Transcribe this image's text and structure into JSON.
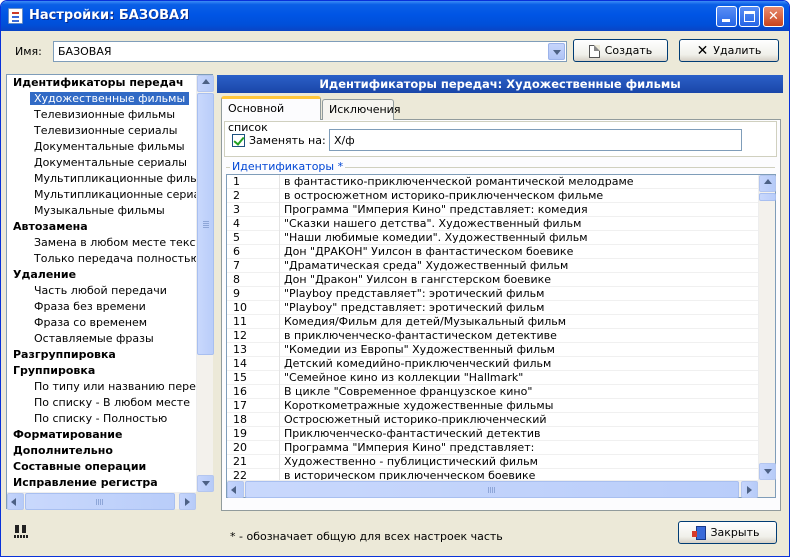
{
  "window": {
    "title": "Настройки: БАЗОВАЯ"
  },
  "name_row": {
    "label": "Имя:",
    "value": "БАЗОВАЯ",
    "create_label": "Создать",
    "delete_label": "Удалить"
  },
  "sidebar": {
    "items": [
      {
        "label": "Идентификаторы передач",
        "kind": "cat"
      },
      {
        "label": "Художественные фильмы",
        "kind": "sub",
        "selected": true
      },
      {
        "label": "Телевизионные фильмы",
        "kind": "sub"
      },
      {
        "label": "Телевизионные сериалы",
        "kind": "sub"
      },
      {
        "label": "Документальные фильмы",
        "kind": "sub"
      },
      {
        "label": "Документальные сериалы",
        "kind": "sub"
      },
      {
        "label": "Мультипликационные фильмы",
        "kind": "sub"
      },
      {
        "label": "Мультипликационные сериалы",
        "kind": "sub"
      },
      {
        "label": "Музыкальные фильмы",
        "kind": "sub"
      },
      {
        "label": "Автозамена",
        "kind": "cat"
      },
      {
        "label": "Замена в любом месте текста",
        "kind": "sub"
      },
      {
        "label": "Только передача полностью",
        "kind": "sub"
      },
      {
        "label": "Удаление",
        "kind": "cat"
      },
      {
        "label": "Часть любой передачи",
        "kind": "sub"
      },
      {
        "label": "Фраза без времени",
        "kind": "sub"
      },
      {
        "label": "Фраза со временем",
        "kind": "sub"
      },
      {
        "label": "Оставляемые фразы",
        "kind": "sub"
      },
      {
        "label": "Разгруппировка",
        "kind": "cat"
      },
      {
        "label": "Группировка",
        "kind": "cat"
      },
      {
        "label": "По типу или названию передачи",
        "kind": "sub"
      },
      {
        "label": "По списку - В любом месте",
        "kind": "sub"
      },
      {
        "label": "По списку - Полностью",
        "kind": "sub"
      },
      {
        "label": "Форматирование",
        "kind": "cat"
      },
      {
        "label": "Дополнительно",
        "kind": "cat"
      },
      {
        "label": "Составные операции",
        "kind": "cat"
      },
      {
        "label": "Исправление регистра",
        "kind": "cat"
      }
    ]
  },
  "panel": {
    "header": "Идентификаторы передач: Художественные фильмы",
    "tabs": [
      "Основной список",
      "Исключения"
    ],
    "replace_label": "Заменять на:",
    "replace_value": "Х/ф",
    "replace_checked": true,
    "group_label": "Идентификаторы *",
    "rows": [
      {
        "n": "1",
        "text": "в фантастико-приключенческой романтической мелодраме"
      },
      {
        "n": "2",
        "text": "в остросюжетном историко-приключенческом фильме"
      },
      {
        "n": "3",
        "text": "Программа \"Империя Кино\" представляет: комедия"
      },
      {
        "n": "4",
        "text": "\"Сказки нашего детства\". Художественный фильм"
      },
      {
        "n": "5",
        "text": "\"Наши любимые комедии\". Художественный фильм"
      },
      {
        "n": "6",
        "text": "Дон \"ДРАКОН\" Уилсон в фантастическом боевике"
      },
      {
        "n": "7",
        "text": "\"Драматическая среда\" Художественный фильм"
      },
      {
        "n": "8",
        "text": "Дон \"Дракон\" Уилсон в гангстерском боевике"
      },
      {
        "n": "9",
        "text": "\"Playboy представляет\": эротический фильм"
      },
      {
        "n": "10",
        "text": "\"Playboy\" представляет: эротический фильм"
      },
      {
        "n": "11",
        "text": "Комедия/Фильм для детей/Музыкальный фильм"
      },
      {
        "n": "12",
        "text": "в приключенческо-фантастическом детективе"
      },
      {
        "n": "13",
        "text": "\"Комедии из Европы\" Художественный фильм"
      },
      {
        "n": "14",
        "text": "Детский комедийно-приключенческий фильм"
      },
      {
        "n": "15",
        "text": "\"Семейное кино из коллекции \"Hallmark\""
      },
      {
        "n": "16",
        "text": "В цикле \"Современное французское кино\""
      },
      {
        "n": "17",
        "text": "Короткометражные художественные фильмы"
      },
      {
        "n": "18",
        "text": "Остросюжетный историко-приключенческий"
      },
      {
        "n": "19",
        "text": "Приключенческо-фантастический детектив"
      },
      {
        "n": "20",
        "text": "Программа \"Империя Кино\" представляет:"
      },
      {
        "n": "21",
        "text": "Художественно - публицистический фильм"
      },
      {
        "n": "22",
        "text": "в историческом приключенческом боевике"
      }
    ]
  },
  "footer": {
    "note": "* - обозначает общую для всех настроек часть",
    "close_label": "Закрыть"
  }
}
